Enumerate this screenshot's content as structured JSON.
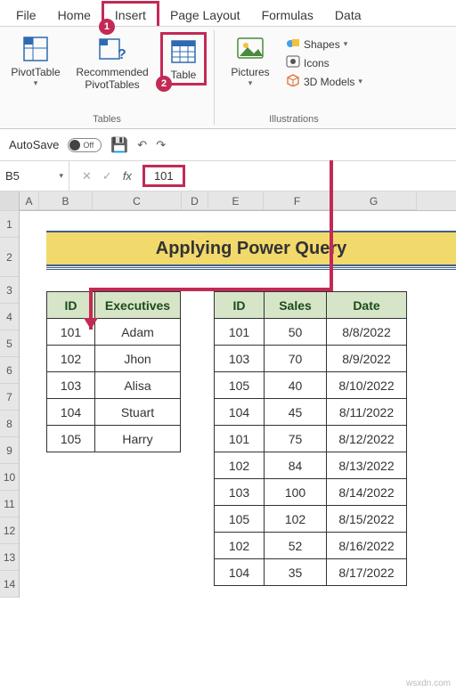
{
  "tabs": {
    "file": "File",
    "home": "Home",
    "insert": "Insert",
    "pagelayout": "Page Layout",
    "formulas": "Formulas",
    "data": "Data"
  },
  "ribbon": {
    "pivot": "PivotTable",
    "recpivot": "Recommended\nPivotTables",
    "table": "Table",
    "tables_group": "Tables",
    "pictures": "Pictures",
    "shapes": "Shapes",
    "icons": "Icons",
    "models": "3D Models",
    "illus_group": "Illustrations"
  },
  "badges": {
    "insert": "1",
    "table": "2"
  },
  "qat": {
    "autosave": "AutoSave",
    "off": "Off"
  },
  "namebox": "B5",
  "formula_value": "101",
  "title_band": "Applying Power Query",
  "colheads": {
    "a": "A",
    "b": "B",
    "c": "C",
    "d": "D",
    "e": "E",
    "f": "F",
    "g": "G"
  },
  "rowheads": [
    "1",
    "2",
    "3",
    "4",
    "5",
    "6",
    "7",
    "8",
    "9",
    "10",
    "11",
    "12",
    "13",
    "14"
  ],
  "table1": {
    "headers": {
      "id": "ID",
      "exec": "Executives"
    },
    "rows": [
      {
        "id": "101",
        "exec": "Adam"
      },
      {
        "id": "102",
        "exec": "Jhon"
      },
      {
        "id": "103",
        "exec": "Alisa"
      },
      {
        "id": "104",
        "exec": "Stuart"
      },
      {
        "id": "105",
        "exec": "Harry"
      }
    ]
  },
  "table2": {
    "headers": {
      "id": "ID",
      "sales": "Sales",
      "date": "Date"
    },
    "rows": [
      {
        "id": "101",
        "sales": "50",
        "date": "8/8/2022"
      },
      {
        "id": "103",
        "sales": "70",
        "date": "8/9/2022"
      },
      {
        "id": "105",
        "sales": "40",
        "date": "8/10/2022"
      },
      {
        "id": "104",
        "sales": "45",
        "date": "8/11/2022"
      },
      {
        "id": "101",
        "sales": "75",
        "date": "8/12/2022"
      },
      {
        "id": "102",
        "sales": "84",
        "date": "8/13/2022"
      },
      {
        "id": "103",
        "sales": "100",
        "date": "8/14/2022"
      },
      {
        "id": "105",
        "sales": "102",
        "date": "8/15/2022"
      },
      {
        "id": "102",
        "sales": "52",
        "date": "8/16/2022"
      },
      {
        "id": "104",
        "sales": "35",
        "date": "8/17/2022"
      }
    ]
  },
  "watermark": "wsxdn.com"
}
